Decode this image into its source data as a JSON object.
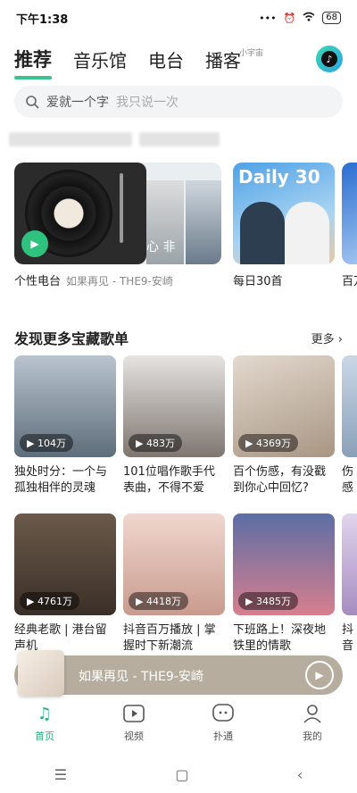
{
  "status": {
    "time": "下午1:38",
    "battery": "68",
    "icons": [
      "more-dots-icon",
      "alarm-icon",
      "hd-icon",
      "wifi-icon",
      "battery-icon"
    ]
  },
  "topnav": {
    "tabs": [
      "推荐",
      "音乐馆",
      "电台",
      "播客"
    ],
    "active": 0,
    "brand_badge": "小宇宙"
  },
  "search": {
    "prefix": "爱就一个字",
    "placeholder": "我只说一次"
  },
  "featured": [
    {
      "label": "个性电台",
      "sub": "如果再见 - THE9-安崎",
      "overlay_text": "心 非"
    },
    {
      "label": "每日30首",
      "title": "Daily 30"
    },
    {
      "label": "百万"
    }
  ],
  "section": {
    "title": "发现更多宝藏歌单",
    "more": "更多"
  },
  "playlists": [
    {
      "count": "104万",
      "name": "独处时分：一个与孤独相伴的灵魂",
      "color": "#7a8b9a"
    },
    {
      "count": "483万",
      "name": "101位唱作歌手代表曲，不得不爱",
      "color": "#c9c3c0"
    },
    {
      "count": "4369万",
      "name": "百个伤感，有没戳到你心中回忆?",
      "color": "#b7b0a6"
    },
    {
      "count": "",
      "name": "伤感曾经",
      "color": "#9fb3c8"
    },
    {
      "count": "4761万",
      "name": "经典老歌 | 港台留声机",
      "color": "#8a7a6a"
    },
    {
      "count": "4418万",
      "name": "抖音百万播放 | 掌握时下新潮流",
      "color": "#e4c9c2"
    },
    {
      "count": "3485万",
      "name": "下班路上！深夜地铁里的情歌",
      "color": "#c27a86"
    },
    {
      "count": "",
      "name": "抖音M系",
      "color": "#c9b6d8"
    }
  ],
  "mini_player": {
    "song": "如果再见 - THE9-安崎"
  },
  "bottom_tabs": [
    {
      "label": "首页",
      "icon": "music-note-icon"
    },
    {
      "label": "视频",
      "icon": "video-play-icon"
    },
    {
      "label": "扑通",
      "icon": "chat-bubble-icon"
    },
    {
      "label": "我的",
      "icon": "person-icon"
    }
  ],
  "active_tab": 0,
  "accent": "#2fc27f"
}
